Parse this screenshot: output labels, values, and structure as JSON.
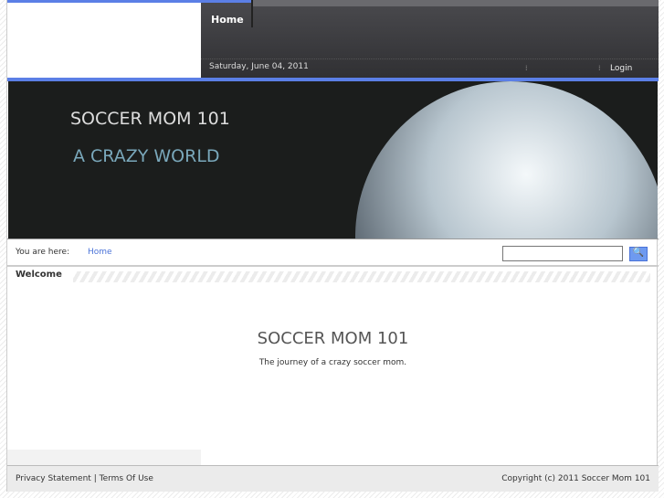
{
  "nav": {
    "home": "Home",
    "date": "Saturday, June 04, 2011",
    "login": "Login"
  },
  "banner": {
    "title": "SOCCER MOM 101",
    "subtitle": "A CRAZY WORLD"
  },
  "breadcrumb": {
    "label": "You are here:",
    "home": "Home"
  },
  "search": {
    "value": "",
    "button_icon": "search-icon"
  },
  "pane": {
    "title": "Welcome"
  },
  "content": {
    "title": "SOCCER MOM 101",
    "subtitle": "The journey of a crazy soccer mom."
  },
  "footer": {
    "privacy": "Privacy Statement",
    "sep": "|",
    "terms": "Terms Of Use",
    "copyright": "Copyright (c) 2011 Soccer Mom 101"
  },
  "colors": {
    "accent": "#5b7fe6",
    "link": "#4a72d8"
  }
}
